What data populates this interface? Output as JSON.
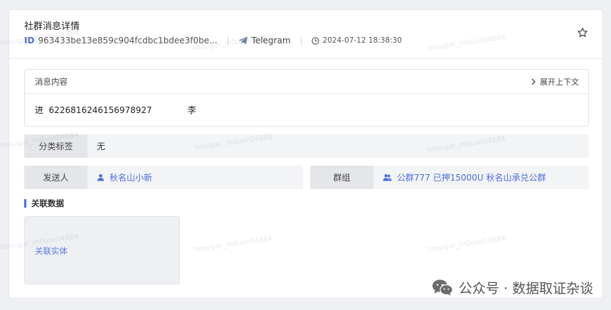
{
  "header": {
    "title": "社群消息详情",
    "id_label": "ID",
    "id_value": "963433be13e859c904fcdbc1bdee3f0be...",
    "platform": "Telegram",
    "timestamp": "2024-07-12 18:38:30"
  },
  "message": {
    "section_label": "消息内容",
    "expand_label": "展开上下文",
    "content_part1": "进  6226816246156978927",
    "content_part2": "李"
  },
  "fields": {
    "category_label": "分类标签",
    "category_value": "无",
    "sender_label": "发送人",
    "sender_value": "秋名山小新",
    "group_label": "群组",
    "group_value": "公群777 已押15000U 秋名山承兑公群"
  },
  "related": {
    "section_title": "关联数据",
    "entity_label": "关联实体"
  },
  "watermark": {
    "text": "nosugar_m0use04884"
  },
  "branding": {
    "text": "公众号 · 数据取证杂谈"
  },
  "colors": {
    "accent": "#4a6ee0",
    "background": "#eef0f3"
  },
  "icons": {
    "platform": "telegram-icon",
    "time": "clock-icon",
    "favorite": "star-icon",
    "expand": "chevron-right-icon",
    "sender": "user-icon",
    "group": "group-icon",
    "brand": "wechat-icon"
  }
}
